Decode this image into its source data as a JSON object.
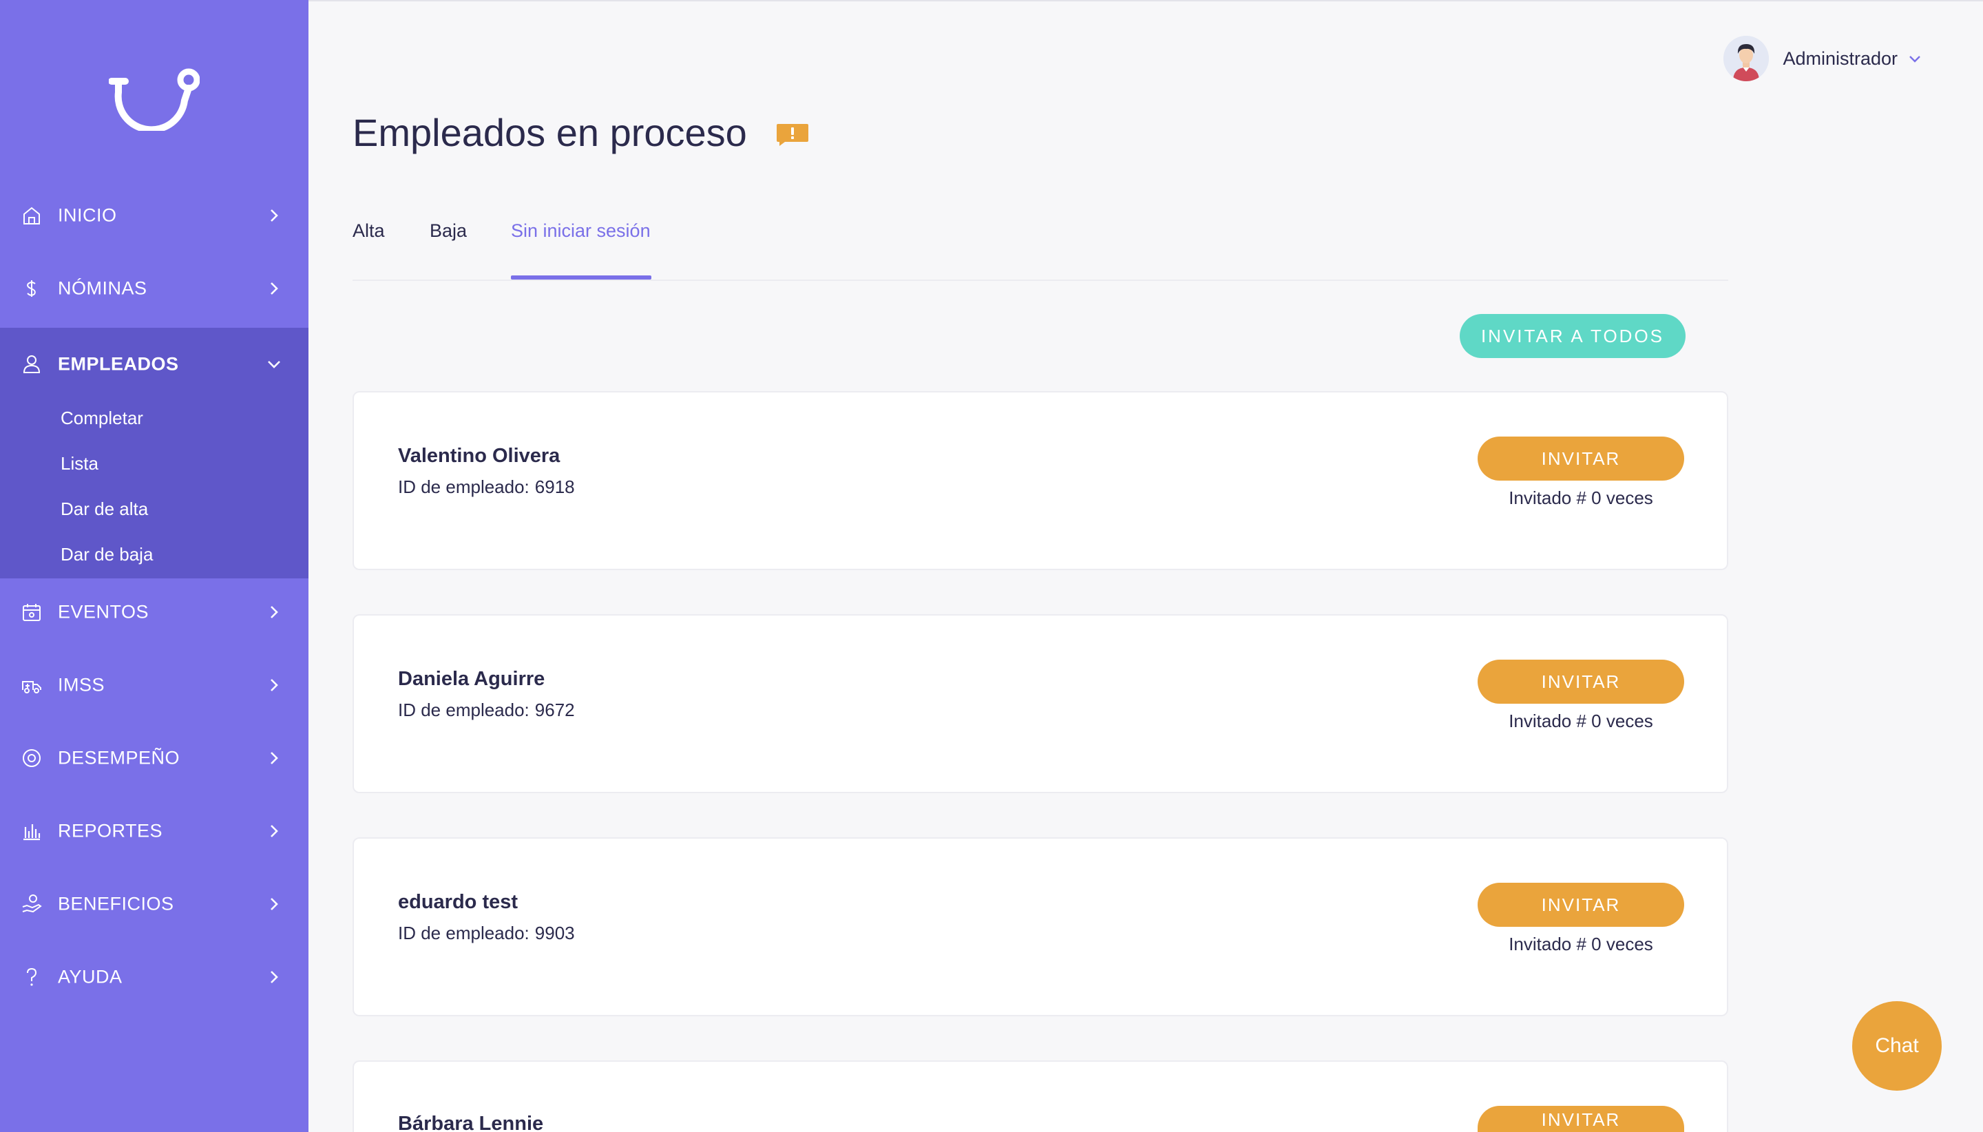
{
  "colors": {
    "sidebar": "#7a70e8",
    "sidebar_active_group": "#5f57c9",
    "accent": "#7a70e8",
    "teal_button": "#5fd8c6",
    "orange_button": "#eaa43c"
  },
  "header": {
    "user_name": "Administrador"
  },
  "sidebar": {
    "items": [
      {
        "label": "INICIO",
        "icon": "home-icon"
      },
      {
        "label": "NÓMINAS",
        "icon": "dollar-icon"
      },
      {
        "label": "EMPLEADOS",
        "icon": "user-icon"
      },
      {
        "label": "EVENTOS",
        "icon": "calendar-icon"
      },
      {
        "label": "IMSS",
        "icon": "ambulance-icon"
      },
      {
        "label": "DESEMPEÑO",
        "icon": "target-icon"
      },
      {
        "label": "REPORTES",
        "icon": "bar-chart-icon"
      },
      {
        "label": "BENEFICIOS",
        "icon": "hand-coin-icon"
      },
      {
        "label": "AYUDA",
        "icon": "question-icon"
      }
    ],
    "employees_submenu": [
      "Completar",
      "Lista",
      "Dar de alta",
      "Dar de baja"
    ]
  },
  "main": {
    "title": "Empleados en proceso",
    "tabs": [
      "Alta",
      "Baja",
      "Sin iniciar sesión"
    ],
    "active_tab": "Sin iniciar sesión",
    "invite_all_label": "INVITAR A TODOS",
    "employees": [
      {
        "name": "Valentino Olivera",
        "id_label": "ID de empleado:",
        "id": "6918",
        "invite_label": "INVITAR",
        "invited_text": "Invitado # 0 veces"
      },
      {
        "name": "Daniela Aguirre",
        "id_label": "ID de empleado:",
        "id": "9672",
        "invite_label": "INVITAR",
        "invited_text": "Invitado # 0 veces"
      },
      {
        "name": "eduardo test",
        "id_label": "ID de empleado:",
        "id": "9903",
        "invite_label": "INVITAR",
        "invited_text": "Invitado # 0 veces"
      },
      {
        "name": "Bárbara Lennie",
        "invite_label": "INVITAR"
      }
    ]
  },
  "chat": {
    "label": "Chat"
  }
}
